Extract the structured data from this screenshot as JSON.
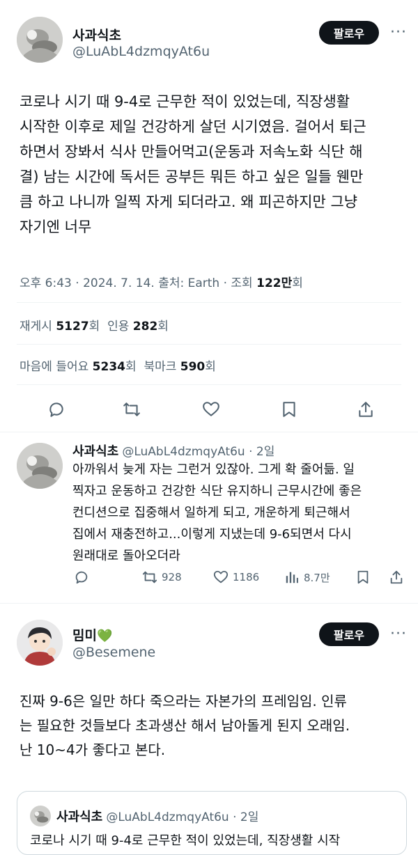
{
  "tweet": {
    "author_name": "사과식초",
    "handle": "@LuAbL4dzmqyAt6u",
    "follow_label": "팔로우",
    "text_lines": [
      "코로나 시기 때 9-4로 근무한 적이 있었는데, 직장생활",
      "시작한 이후로 제일 건강하게 살던 시기였음. 걸어서 퇴근",
      "하면서 장봐서 식사 만들어먹고(운동과 저속노화 식단 해",
      "결) 남는 시간에 독서든 공부든 뭐든 하고 싶은 일들 웬만",
      "큼 하고 나니까 일찍 자게 되더라고. 왜 피곤하지만 그냥",
      "자기엔 너무"
    ],
    "meta_prefix": "오후 6:43 · 2024. 7. 14. 출처: Earth · 조회 ",
    "views_value": "122만",
    "views_suffix": "회",
    "retweets_label": "재게시",
    "retweets_value": "5127",
    "quotes_label": "인용",
    "quotes_value": "282",
    "likes_label": "마음에 들어요",
    "likes_value": "5234",
    "bookmarks_label": "북마크",
    "bookmarks_value": "590",
    "unit": "회"
  },
  "reply1": {
    "author_name": "사과식초",
    "handle": "@LuAbL4dzmqyAt6u · 2일",
    "text_lines": [
      "아까워서 늦게 자는 그런거 있잖아. 그게 확 줄어듦. 일",
      "찍자고 운동하고 건강한 식단 유지하니 근무시간에 좋은",
      "컨디션으로 집중해서 일하게 되고, 개운하게 퇴근해서",
      "집에서 재충전하고...이렇게 지냈는데 9-6되면서 다시",
      "원래대로 돌아오더라"
    ],
    "retweets": "928",
    "likes": "1186",
    "views": "8.7만"
  },
  "reply2": {
    "author_name": "밈미",
    "emoji": "💚",
    "handle": "@Besemene",
    "follow_label": "팔로우",
    "text_lines": [
      "진짜 9-6은 일만 하다 죽으라는 자본가의 프레임임. 인류",
      "는 필요한 것들보다 초과생산 해서 남아돌게 된지 오래임.",
      "난 10~4가 좋다고 본다."
    ]
  },
  "quoted": {
    "author_name": "사과식초",
    "handle": "@LuAbL4dzmqyAt6u · 2일",
    "text_partial": "코로나 시기 때 9-4로 근무한 적이 있었는데, 직장생활 시작"
  },
  "icons": [
    "reply-icon",
    "retweet-icon",
    "like-icon",
    "bookmark-icon",
    "share-icon",
    "views-icon",
    "more-icon"
  ]
}
